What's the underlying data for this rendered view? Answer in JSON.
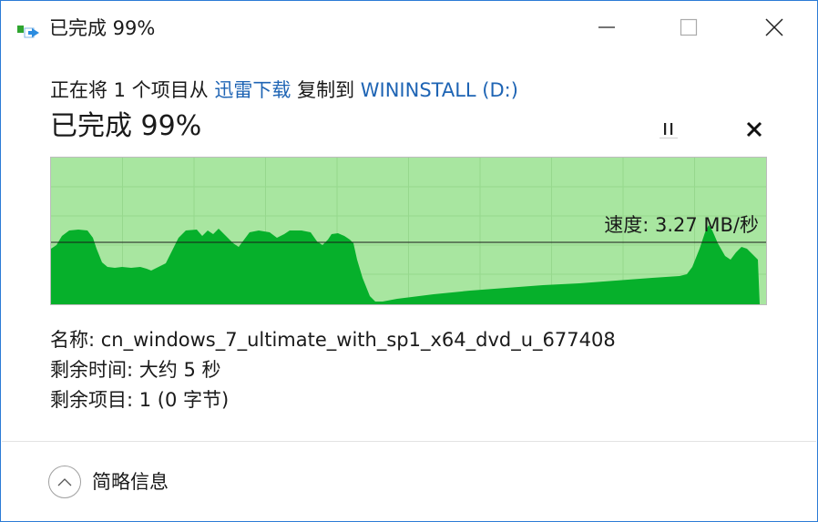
{
  "window": {
    "title": "已完成 99%"
  },
  "transfer": {
    "desc_prefix": "正在将 1 个项目从 ",
    "source": "迅雷下载",
    "desc_middle": " 复制到 ",
    "destination": "WININSTALL (D:)",
    "progress_title": "已完成 99%",
    "progress_percent": 99
  },
  "graph": {
    "speed_label": "速度: 3.27 MB/秒",
    "colors": {
      "background": "#a8e6a0",
      "fill": "#06b02b",
      "grid": "#9ad892",
      "line": "#1a1a1a"
    }
  },
  "details": {
    "name_label": "名称: ",
    "name_value": "cn_windows_7_ultimate_with_sp1_x64_dvd_u_677408",
    "time_label": "剩余时间: ",
    "time_value": "大约 5 秒",
    "items_label": "剩余项目: ",
    "items_value": "1 (0 字节)"
  },
  "footer": {
    "toggle_label": "简略信息"
  }
}
